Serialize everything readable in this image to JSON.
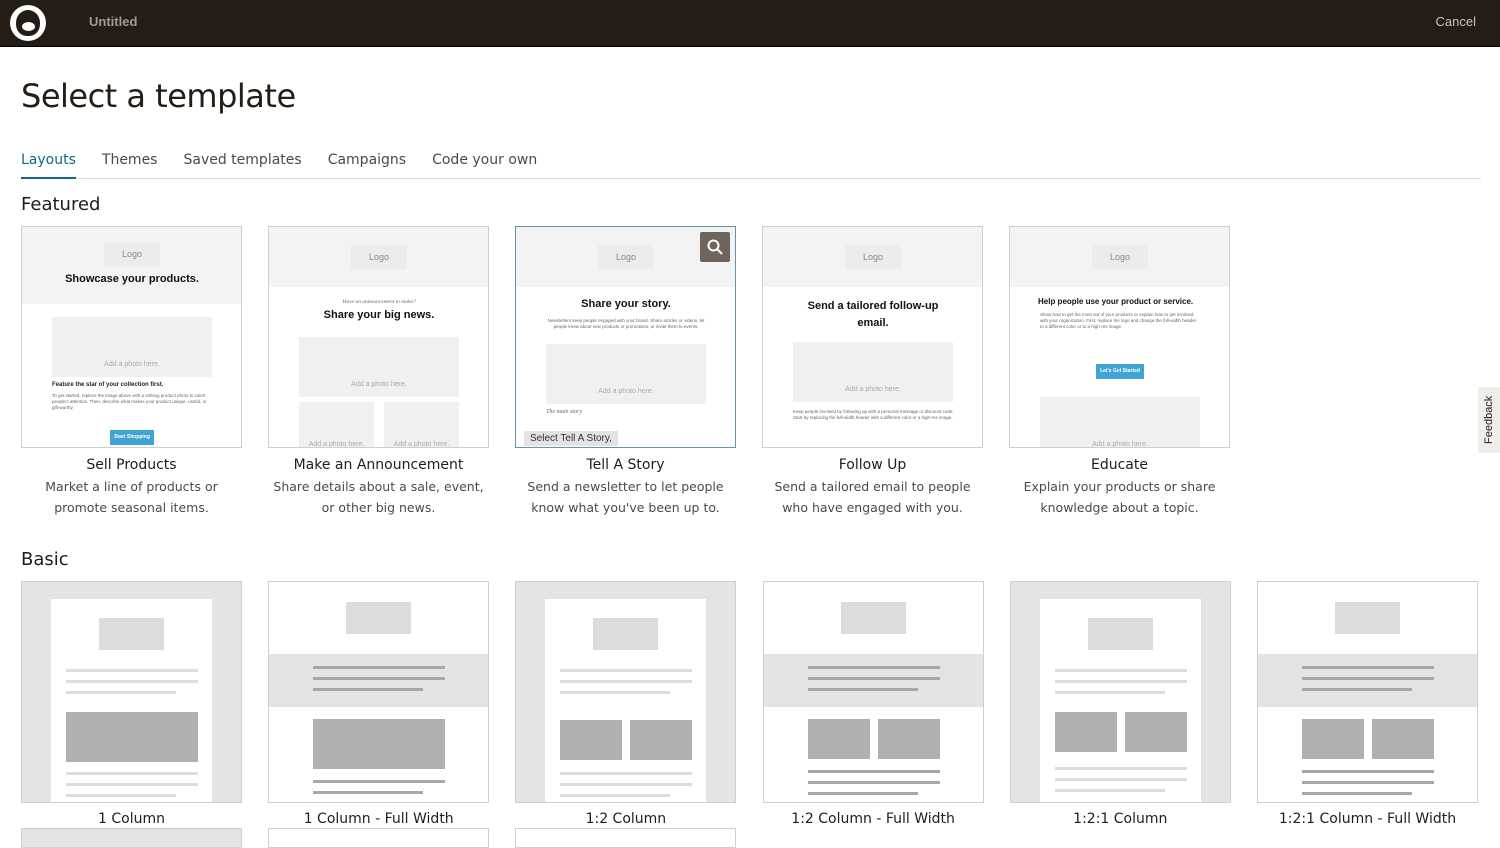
{
  "header": {
    "title": "Untitled",
    "cancel": "Cancel"
  },
  "page_title": "Select a template",
  "tabs": [
    "Layouts",
    "Themes",
    "Saved templates",
    "Campaigns",
    "Code your own"
  ],
  "featured": {
    "heading": "Featured",
    "cards": [
      {
        "name": "Sell Products",
        "desc": "Market a line of products or promote seasonal items.",
        "preview": {
          "logo": "Logo",
          "headline": "Showcase your products.",
          "photo": "Add a photo here.",
          "sub": "Feature the star of your collection first.",
          "body": "To get started, replace the image above with a striking product photo to catch people's attention. Then, describe what makes your product unique, useful, or gift-worthy.",
          "button": "Start Shopping"
        }
      },
      {
        "name": "Make an Announcement",
        "desc": "Share details about a sale, event, or other big news.",
        "preview": {
          "logo": "Logo",
          "kicker": "Have an announcement to make?",
          "headline": "Share your big news.",
          "photo": "Add a photo here."
        }
      },
      {
        "name": "Tell A Story",
        "desc": "Send a newsletter to let people know what you've been up to.",
        "preview": {
          "logo": "Logo",
          "headline": "Share your story.",
          "body": "Newsletters keep people engaged with your brand. Share articles or videos, let people know about new products or promotions, or invite them to events.",
          "photo": "Add a photo here.",
          "sub": "The main story",
          "tooltip": "Select Tell A Story,"
        }
      },
      {
        "name": "Follow Up",
        "desc": "Send a tailored email to people who have engaged with you.",
        "preview": {
          "logo": "Logo",
          "headline": "Send a tailored follow-up email.",
          "photo": "Add a photo here.",
          "body": "Keep people involved by following up with a personal message or discount code. Start by replacing the full-width header with a different color or a high-res image."
        }
      },
      {
        "name": "Educate",
        "desc": "Explain your products or share knowledge about a topic.",
        "preview": {
          "logo": "Logo",
          "headline": "Help people use your product or service.",
          "body": "Show how to get the most out of your products or explain how to get involved with your organization. First, replace the logo and change the full-width header to a different color or to a high-res image.",
          "button": "Let's Get Started",
          "photo": "Add a photo here."
        }
      }
    ]
  },
  "basic": {
    "heading": "Basic",
    "cards": [
      {
        "name": "1 Column",
        "layout": "1",
        "full": false
      },
      {
        "name": "1 Column - Full Width",
        "layout": "1",
        "full": true
      },
      {
        "name": "1:2 Column",
        "layout": "2",
        "full": false
      },
      {
        "name": "1:2 Column - Full Width",
        "layout": "2",
        "full": true
      },
      {
        "name": "1:2:1 Column",
        "layout": "2",
        "full": false
      },
      {
        "name": "1:2:1 Column - Full Width",
        "layout": "2",
        "full": true
      }
    ]
  },
  "feedback": "Feedback"
}
